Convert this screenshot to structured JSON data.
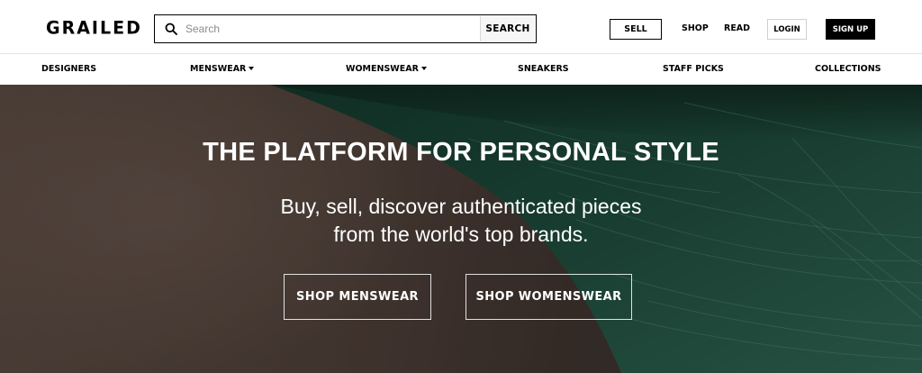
{
  "header": {
    "logo": "GRAILED",
    "search": {
      "placeholder": "Search",
      "button_label": "SEARCH"
    },
    "sell_label": "SELL",
    "shop_label": "SHOP",
    "read_label": "READ",
    "login_label": "LOGIN",
    "signup_label": "SIGN UP"
  },
  "subnav": {
    "items": [
      {
        "label": "DESIGNERS",
        "dropdown": false
      },
      {
        "label": "MENSWEAR",
        "dropdown": true
      },
      {
        "label": "WOMENSWEAR",
        "dropdown": true
      },
      {
        "label": "SNEAKERS",
        "dropdown": false
      },
      {
        "label": "STAFF PICKS",
        "dropdown": false
      },
      {
        "label": "COLLECTIONS",
        "dropdown": false
      }
    ]
  },
  "hero": {
    "title": "THE PLATFORM FOR PERSONAL STYLE",
    "subtitle_line1": "Buy, sell, discover authenticated pieces",
    "subtitle_line2": "from the world's top brands.",
    "btn_menswear": "SHOP MENSWEAR",
    "btn_womenswear": "SHOP WOMENSWEAR"
  },
  "colors": {
    "brand_black": "#000000",
    "hero_brown": "#4e3f38",
    "hero_green": "#1f4a3a"
  }
}
